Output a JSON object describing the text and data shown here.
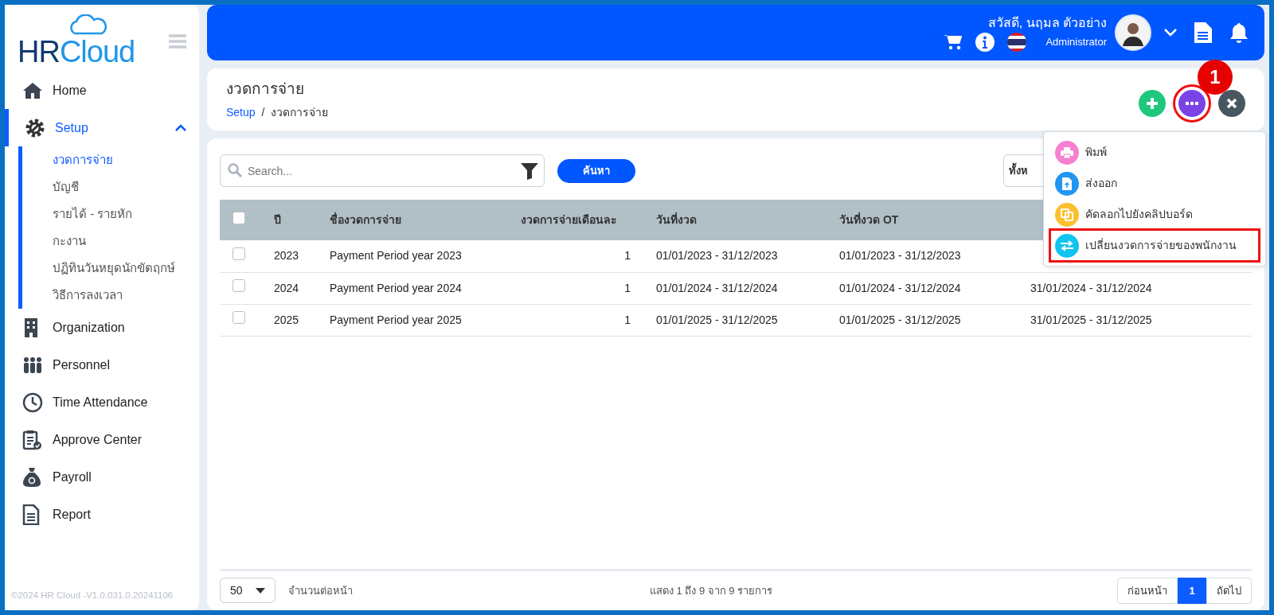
{
  "sidebar": {
    "logo": {
      "part_1": "HR",
      "part_2": "Cloud"
    },
    "items": [
      {
        "label": "Home",
        "selected": false
      },
      {
        "label": "Setup",
        "selected": true,
        "expanded": true,
        "children": [
          {
            "label": "งวดการจ่าย",
            "selected": true
          },
          {
            "label": "บัญชี",
            "selected": false
          },
          {
            "label": "รายได้ - รายหัก",
            "selected": false
          },
          {
            "label": "กะงาน",
            "selected": false
          },
          {
            "label": "ปฏิทินวันหยุดนักขัตฤกษ์",
            "selected": false
          },
          {
            "label": "วิธีการลงเวลา",
            "selected": false
          }
        ]
      },
      {
        "label": "Organization",
        "selected": false
      },
      {
        "label": "Personnel",
        "selected": false
      },
      {
        "label": "Time Attendance",
        "selected": false
      },
      {
        "label": "Approve Center",
        "selected": false
      },
      {
        "label": "Payroll",
        "selected": false
      },
      {
        "label": "Report",
        "selected": false
      }
    ],
    "copyright": "©2024 HR Cloud -V1.0.031.0.20241106"
  },
  "topbar": {
    "greeting": "สวัสดี, นฤมล ตัวอย่าง",
    "role": "Administrator"
  },
  "page_header": {
    "title": "งวดการจ่าย",
    "breadcrumb": [
      {
        "label": "Setup",
        "link": true
      },
      {
        "label": "งวดการจ่าย",
        "link": false
      }
    ],
    "breadcrumb_separator": "/",
    "actions": [
      {
        "kind": "add",
        "highlighted": false
      },
      {
        "kind": "more",
        "highlighted": true,
        "marker": "1"
      },
      {
        "kind": "close",
        "highlighted": false
      }
    ]
  },
  "menu": {
    "items": [
      {
        "label": "พิมพ์",
        "color": "#f67fd0",
        "highlighted": false
      },
      {
        "label": "ส่งออก",
        "color": "#2196f3",
        "highlighted": false
      },
      {
        "label": "คัดลอกไปยังคลิปบอร์ด",
        "color": "#fbc02d",
        "highlighted": false
      },
      {
        "label": "เปลี่ยนงวดการจ่ายของพนักงาน",
        "color": "#10c4ee",
        "highlighted": true
      }
    ]
  },
  "toolbar": {
    "search": {
      "placeholder": "Search..."
    },
    "search_button": "ค้นหา",
    "filter_select": "ทั้งห"
  },
  "table": {
    "select_all_checked": false,
    "columns": [
      "ปี",
      "ชื่องวดการจ่าย",
      "งวดการจ่ายเดือนละ",
      "วันที่งวด",
      "วันที่งวด OT"
    ],
    "rows": [
      {
        "checked": false,
        "cells": [
          "2023",
          "Payment Period year 2023",
          "1",
          "01/01/2023 - 31/12/2023",
          "01/01/2023 - 31/12/2023"
        ]
      },
      {
        "checked": false,
        "cells": [
          "2024",
          "Payment Period year 2024",
          "1",
          "01/01/2024 - 31/12/2024",
          "01/01/2024 - 31/12/2024",
          "31/01/2024 - 31/12/2024"
        ]
      },
      {
        "checked": false,
        "cells": [
          "2025",
          "Payment Period year 2025",
          "1",
          "01/01/2025 - 31/12/2025",
          "01/01/2025 - 31/12/2025",
          "31/01/2025 - 31/12/2025"
        ]
      }
    ]
  },
  "footer": {
    "page_size": "50",
    "page_size_label": "จำนวนต่อหน้า",
    "summary": "แสดง 1 ถึง 9 จาก 9 รายการ",
    "pages": [
      {
        "label": "ก่อนหน้า",
        "selected": false
      },
      {
        "label": "1",
        "selected": true
      },
      {
        "label": "ถัดไป",
        "selected": false
      }
    ]
  }
}
